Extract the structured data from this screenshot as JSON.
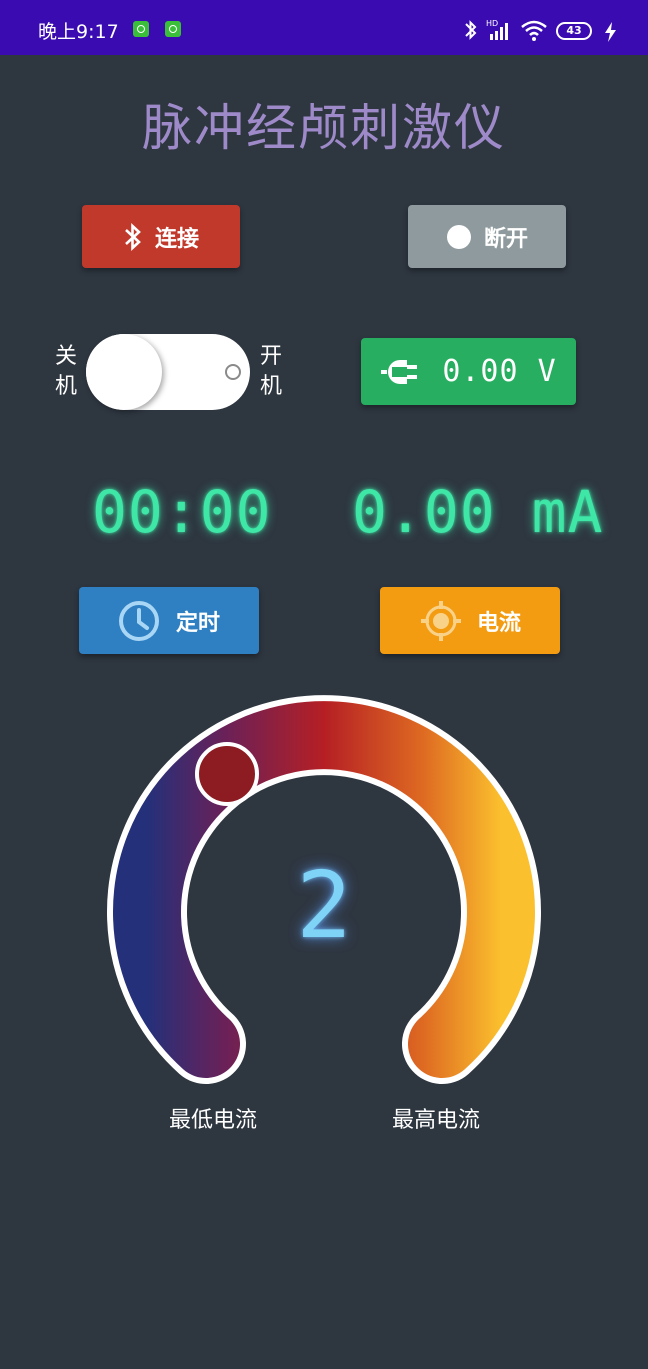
{
  "status_bar": {
    "time": "晚上9:17",
    "battery": "43"
  },
  "app": {
    "title": "脉冲经颅刺激仪"
  },
  "buttons": {
    "connect_label": "连接",
    "disconnect_label": "断开",
    "timer_label": "定时",
    "current_label": "电流"
  },
  "power_switch": {
    "off_label_1": "关",
    "off_label_2": "机",
    "on_label_1": "开",
    "on_label_2": "机",
    "state": "off"
  },
  "voltage": {
    "value": "0.00 V"
  },
  "readouts": {
    "timer": "00:00",
    "current": "0.00 mA"
  },
  "dial": {
    "level": "2",
    "min_label": "最低电流",
    "max_label": "最高电流"
  },
  "colors": {
    "background": "#2e3640",
    "status_bar": "#3a0bb0",
    "connect": "#c0392b",
    "disconnect": "#8e9a9d",
    "voltage": "#27ae60",
    "timer": "#2f80c3",
    "current": "#f39c12",
    "lcd_green": "#3fe7a7",
    "dial_number": "#7ed3f7"
  }
}
